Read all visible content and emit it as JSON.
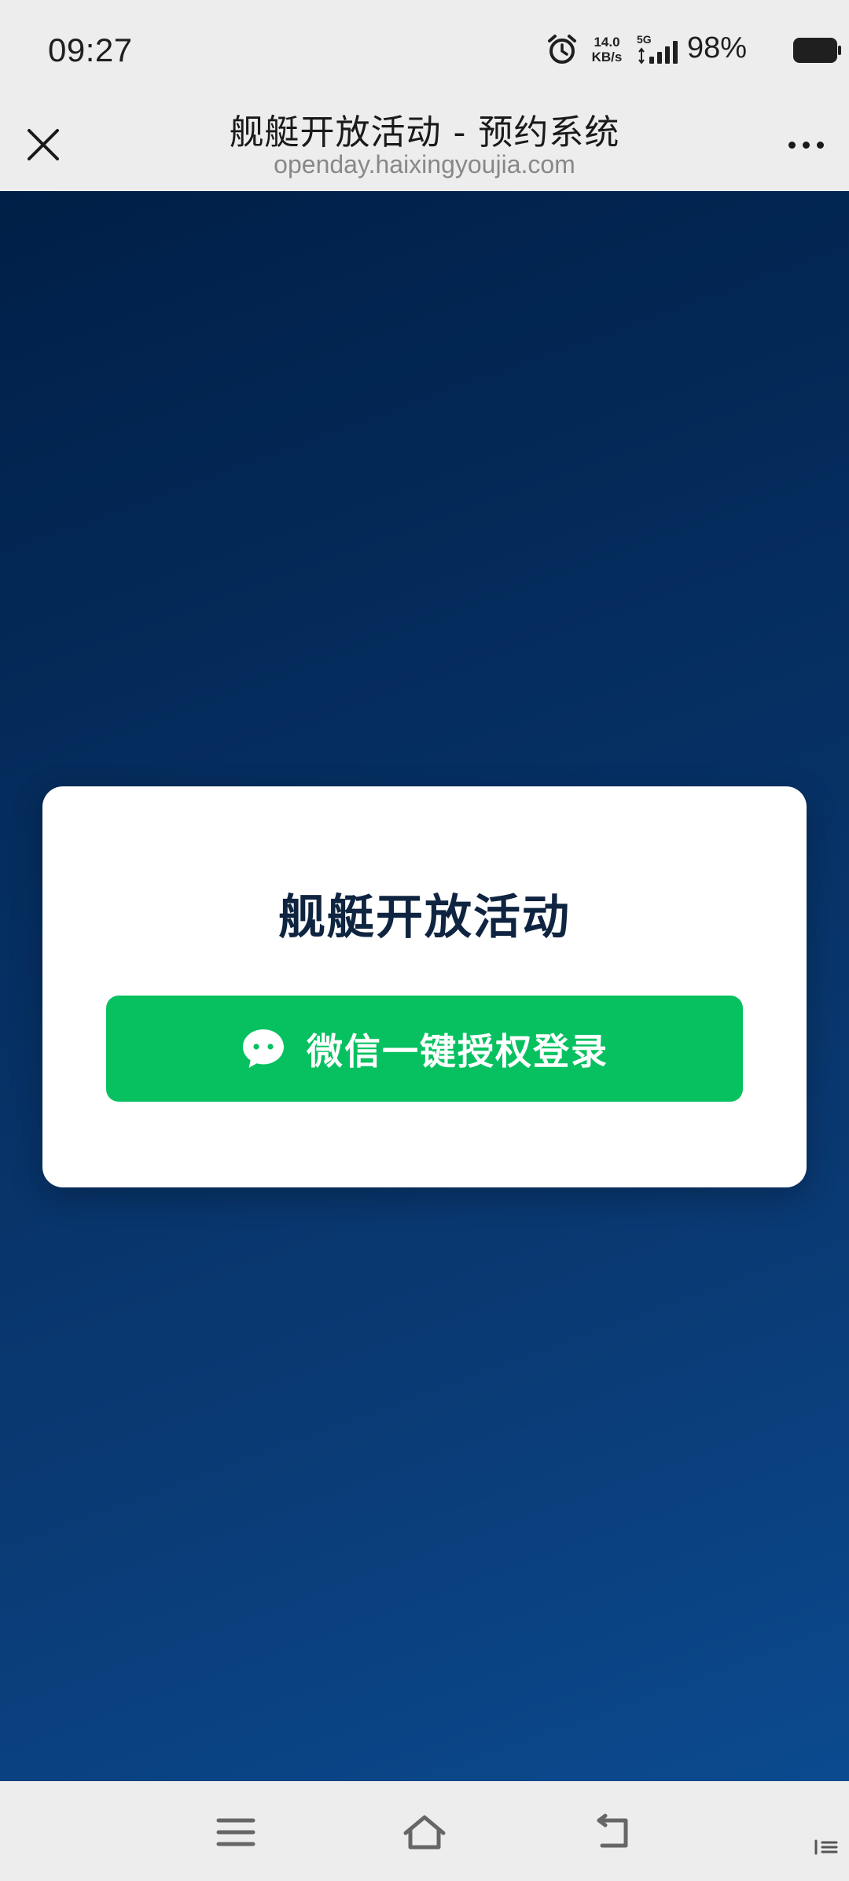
{
  "status_bar": {
    "time": "09:27",
    "net_speed_value": "14.0",
    "net_speed_unit": "KB/s",
    "network_type": "5G",
    "battery_percent": "98%"
  },
  "nav": {
    "title": "舰艇开放活动 - 预约系统",
    "url": "openday.haixingyoujia.com"
  },
  "card": {
    "title": "舰艇开放活动",
    "login_button_label": "微信一键授权登录"
  },
  "colors": {
    "wechat_green": "#07c160",
    "background_dark": "#001f47",
    "background_light": "#0b4a8f",
    "card_title": "#0f2440"
  },
  "icons": {
    "close": "close-icon",
    "more": "more-icon",
    "wechat": "wechat-icon",
    "menu": "menu-icon",
    "home": "home-icon",
    "back": "back-icon"
  }
}
